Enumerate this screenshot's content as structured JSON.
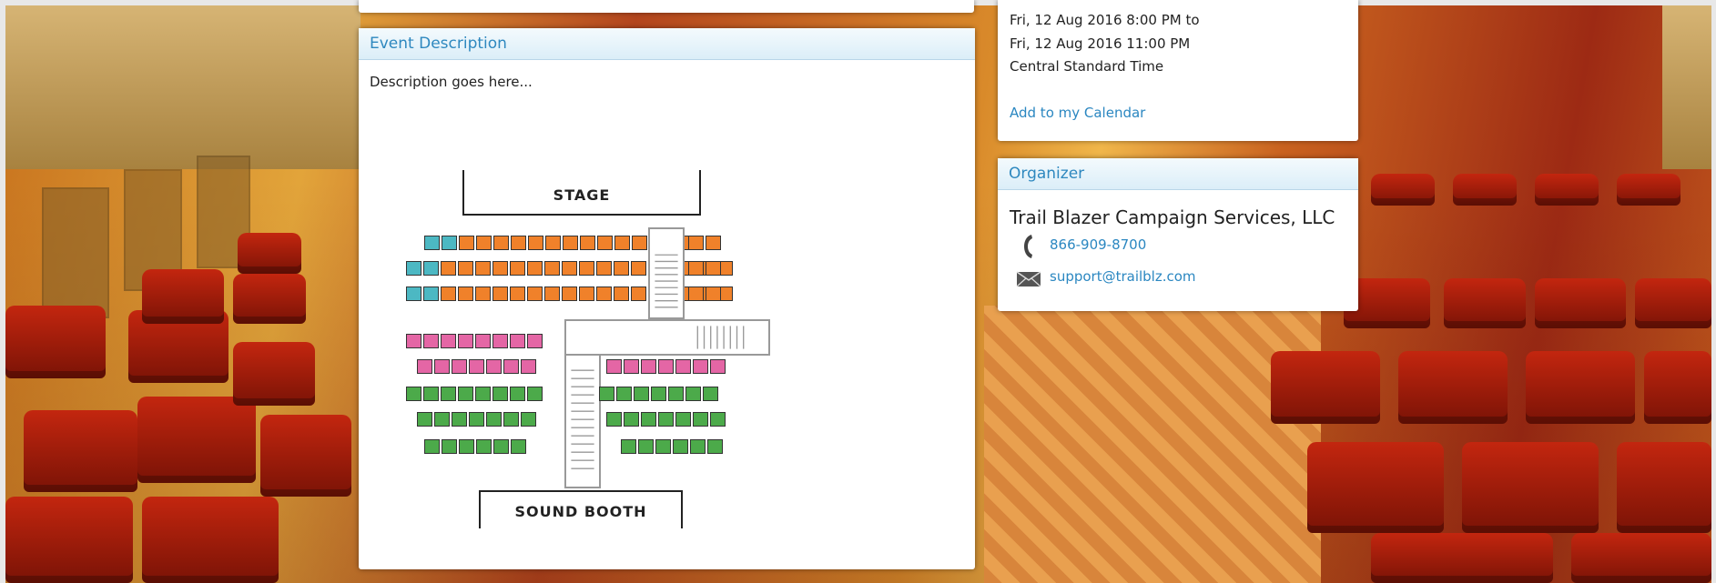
{
  "event_time": {
    "start": "Fri, 12 Aug 2016 8:00 PM to",
    "end": "Fri, 12 Aug 2016 11:00 PM",
    "timezone": "Central Standard Time",
    "add_calendar": "Add to my Calendar"
  },
  "description": {
    "header": "Event Description",
    "body": "Description goes here...",
    "seatmap": {
      "stage_label": "STAGE",
      "booth_label": "SOUND BOOTH"
    }
  },
  "organizer": {
    "header": "Organizer",
    "name": "Trail Blazer Campaign Services, LLC",
    "phone": "866-909-8700",
    "email": "support@trailblz.com"
  },
  "colors": {
    "accent": "#2e88bf",
    "seat_teal": "#4cb8c3",
    "seat_orange": "#f0812a",
    "seat_pink": "#e466a5",
    "seat_green": "#4caa4a"
  },
  "icons": [
    "phone-icon",
    "email-icon"
  ]
}
